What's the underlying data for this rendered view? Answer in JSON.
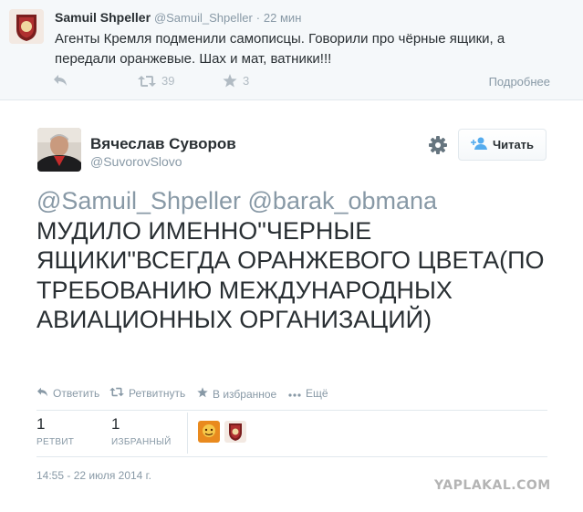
{
  "parent_tweet": {
    "name": "Samuil Shpeller",
    "handle": "@Samuil_Shpeller",
    "separator": "·",
    "time": "22 мин",
    "text": "Агенты Кремля подменили самописцы. Говорили про чёрные ящики, а передали оранжевые. Шах и мат, ватники!!!",
    "retweet_count": "39",
    "favorite_count": "3",
    "more_label": "Подробнее",
    "icons": {
      "reply": "reply-icon",
      "retweet": "retweet-icon",
      "favorite": "star-icon"
    }
  },
  "tweet": {
    "name": "Вячеслав Суворов",
    "handle": "@SuvorovSlovo",
    "follow_label": "Читать",
    "mentions": "@Samuil_Shpeller @barak_obmana",
    "body": "МУДИЛО ИМЕННО\"ЧЕРНЫЕ ЯЩИКИ\"ВСЕГДА ОРАНЖЕВОГО ЦВЕТА(ПО ТРЕБОВАНИЮ МЕЖДУНАРОДНЫХ АВИАЦИОННЫХ ОРГАНИЗАЦИЙ)",
    "actions": {
      "reply": "Ответить",
      "retweet": "Ретвитнуть",
      "favorite": "В избранное",
      "more": "Ещё"
    },
    "stats": {
      "retweets_count": "1",
      "retweets_label": "РЕТВИТ",
      "favorites_count": "1",
      "favorites_label": "ИЗБРАННЫЙ"
    },
    "timestamp": "14:55 - 22 июля 2014 г."
  },
  "watermark": "YAPLAKAL.COM",
  "colors": {
    "accent": "#55acee",
    "text": "#292f33",
    "muted": "#8899a6",
    "parent_bg": "#f5f8fa",
    "border": "#e1e8ed"
  }
}
